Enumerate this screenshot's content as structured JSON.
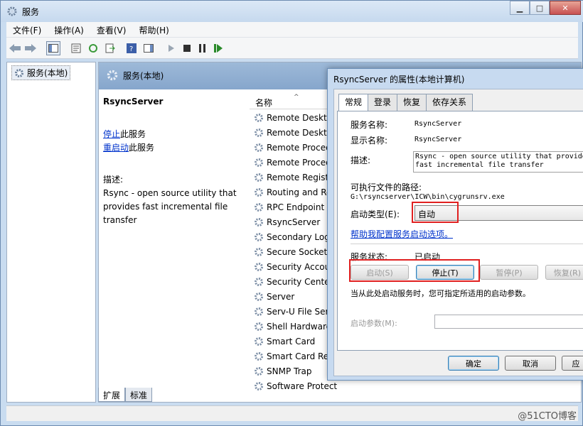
{
  "window": {
    "title": "服务",
    "min": "▁",
    "max": "□",
    "close": "✕"
  },
  "menu": [
    "文件(F)",
    "操作(A)",
    "查看(V)",
    "帮助(H)"
  ],
  "tree": {
    "root": "服务(本地)"
  },
  "pane": {
    "header": "服务(本地)"
  },
  "detail": {
    "service_name": "RsyncServer",
    "stop_link": "停止",
    "stop_suffix": "此服务",
    "restart_link": "重启动",
    "restart_suffix": "此服务",
    "desc_label": "描述:",
    "desc_lines": [
      "Rsync - open source utility that",
      "provides fast incremental file",
      "transfer"
    ]
  },
  "list": {
    "column_name": "名称",
    "rows": [
      "Remote Deskto",
      "Remote Deskto",
      "Remote Proced",
      "Remote Proced",
      "Remote Regist",
      "Routing and Re",
      "RPC Endpoint M",
      "RsyncServer",
      "Secondary Log",
      "Secure Socket",
      "Security Accou",
      "Security Center",
      "Server",
      "Serv-U File Ser",
      "Shell Hardware",
      "Smart Card",
      "Smart Card Re",
      "SNMP Trap",
      "Software Protect"
    ]
  },
  "bottom_tabs": [
    "扩展",
    "标准"
  ],
  "watermark": "@51CTO博客",
  "dialog": {
    "title": "RsyncServer 的属性(本地计算机)",
    "tabs": [
      "常规",
      "登录",
      "恢复",
      "依存关系"
    ],
    "service_name_label": "服务名称:",
    "service_name_value": "RsyncServer",
    "display_name_label": "显示名称:",
    "display_name_value": "RsyncServer",
    "description_label": "描述:",
    "description_lines": [
      "Rsync - open source utility that provide",
      "fast incremental file transfer"
    ],
    "exe_path_label": "可执行文件的路径:",
    "exe_path_value": "G:\\rsyncserver\\ICW\\bin\\cygrunsrv.exe",
    "startup_type_label": "启动类型(E):",
    "startup_type_value": "自动",
    "help_link": "帮助我配置服务启动选项。",
    "status_label": "服务状态:",
    "status_value": "已启动",
    "buttons": {
      "start": "启动(S)",
      "stop": "停止(T)",
      "pause": "暂停(P)",
      "resume": "恢复(R)"
    },
    "hint": "当从此处启动服务时，您可指定所适用的启动参数。",
    "params_label": "启动参数(M):",
    "ok": "确定",
    "cancel": "取消",
    "apply": "应"
  }
}
